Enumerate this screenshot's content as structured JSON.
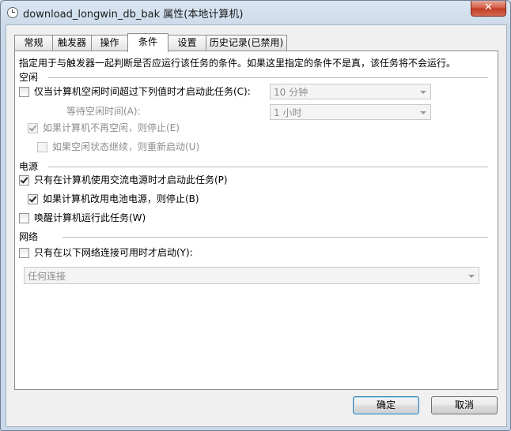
{
  "window": {
    "title": "download_longwin_db_bak 属性(本地计算机)",
    "close_glyph": "✕"
  },
  "tabs": [
    {
      "label": "常规"
    },
    {
      "label": "触发器"
    },
    {
      "label": "操作"
    },
    {
      "label": "条件",
      "active": true
    },
    {
      "label": "设置"
    },
    {
      "label": "历史记录(已禁用)"
    }
  ],
  "conditions": {
    "description": "指定用于与触发器一起判断是否应运行该任务的条件。如果这里指定的条件不是真，该任务将不会运行。",
    "idle": {
      "section": "空闲",
      "start_only_if_idle": {
        "label": "仅当计算机空闲时间超过下列值时才启动此任务(C):",
        "checked": false
      },
      "idle_duration": {
        "value": "10 分钟"
      },
      "wait_label": "等待空闲时间(A):",
      "wait_value": {
        "value": "1 小时"
      },
      "stop_if_not_idle": {
        "label": "如果计算机不再空闲，则停止(E)",
        "checked": true,
        "enabled": false
      },
      "restart_if_idle": {
        "label": "如果空闲状态继续，则重新启动(U)",
        "checked": false,
        "enabled": false
      }
    },
    "power": {
      "section": "电源",
      "ac_only": {
        "label": "只有在计算机使用交流电源时才启动此任务(P)",
        "checked": true
      },
      "stop_on_battery": {
        "label": "如果计算机改用电池电源，则停止(B)",
        "checked": true
      },
      "wake_to_run": {
        "label": "唤醒计算机运行此任务(W)",
        "checked": false
      }
    },
    "network": {
      "section": "网络",
      "start_only_if_network": {
        "label": "只有在以下网络连接可用时才启动(Y):",
        "checked": false
      },
      "connection": {
        "value": "任何连接"
      }
    }
  },
  "buttons": {
    "ok": "确定",
    "cancel": "取消"
  }
}
